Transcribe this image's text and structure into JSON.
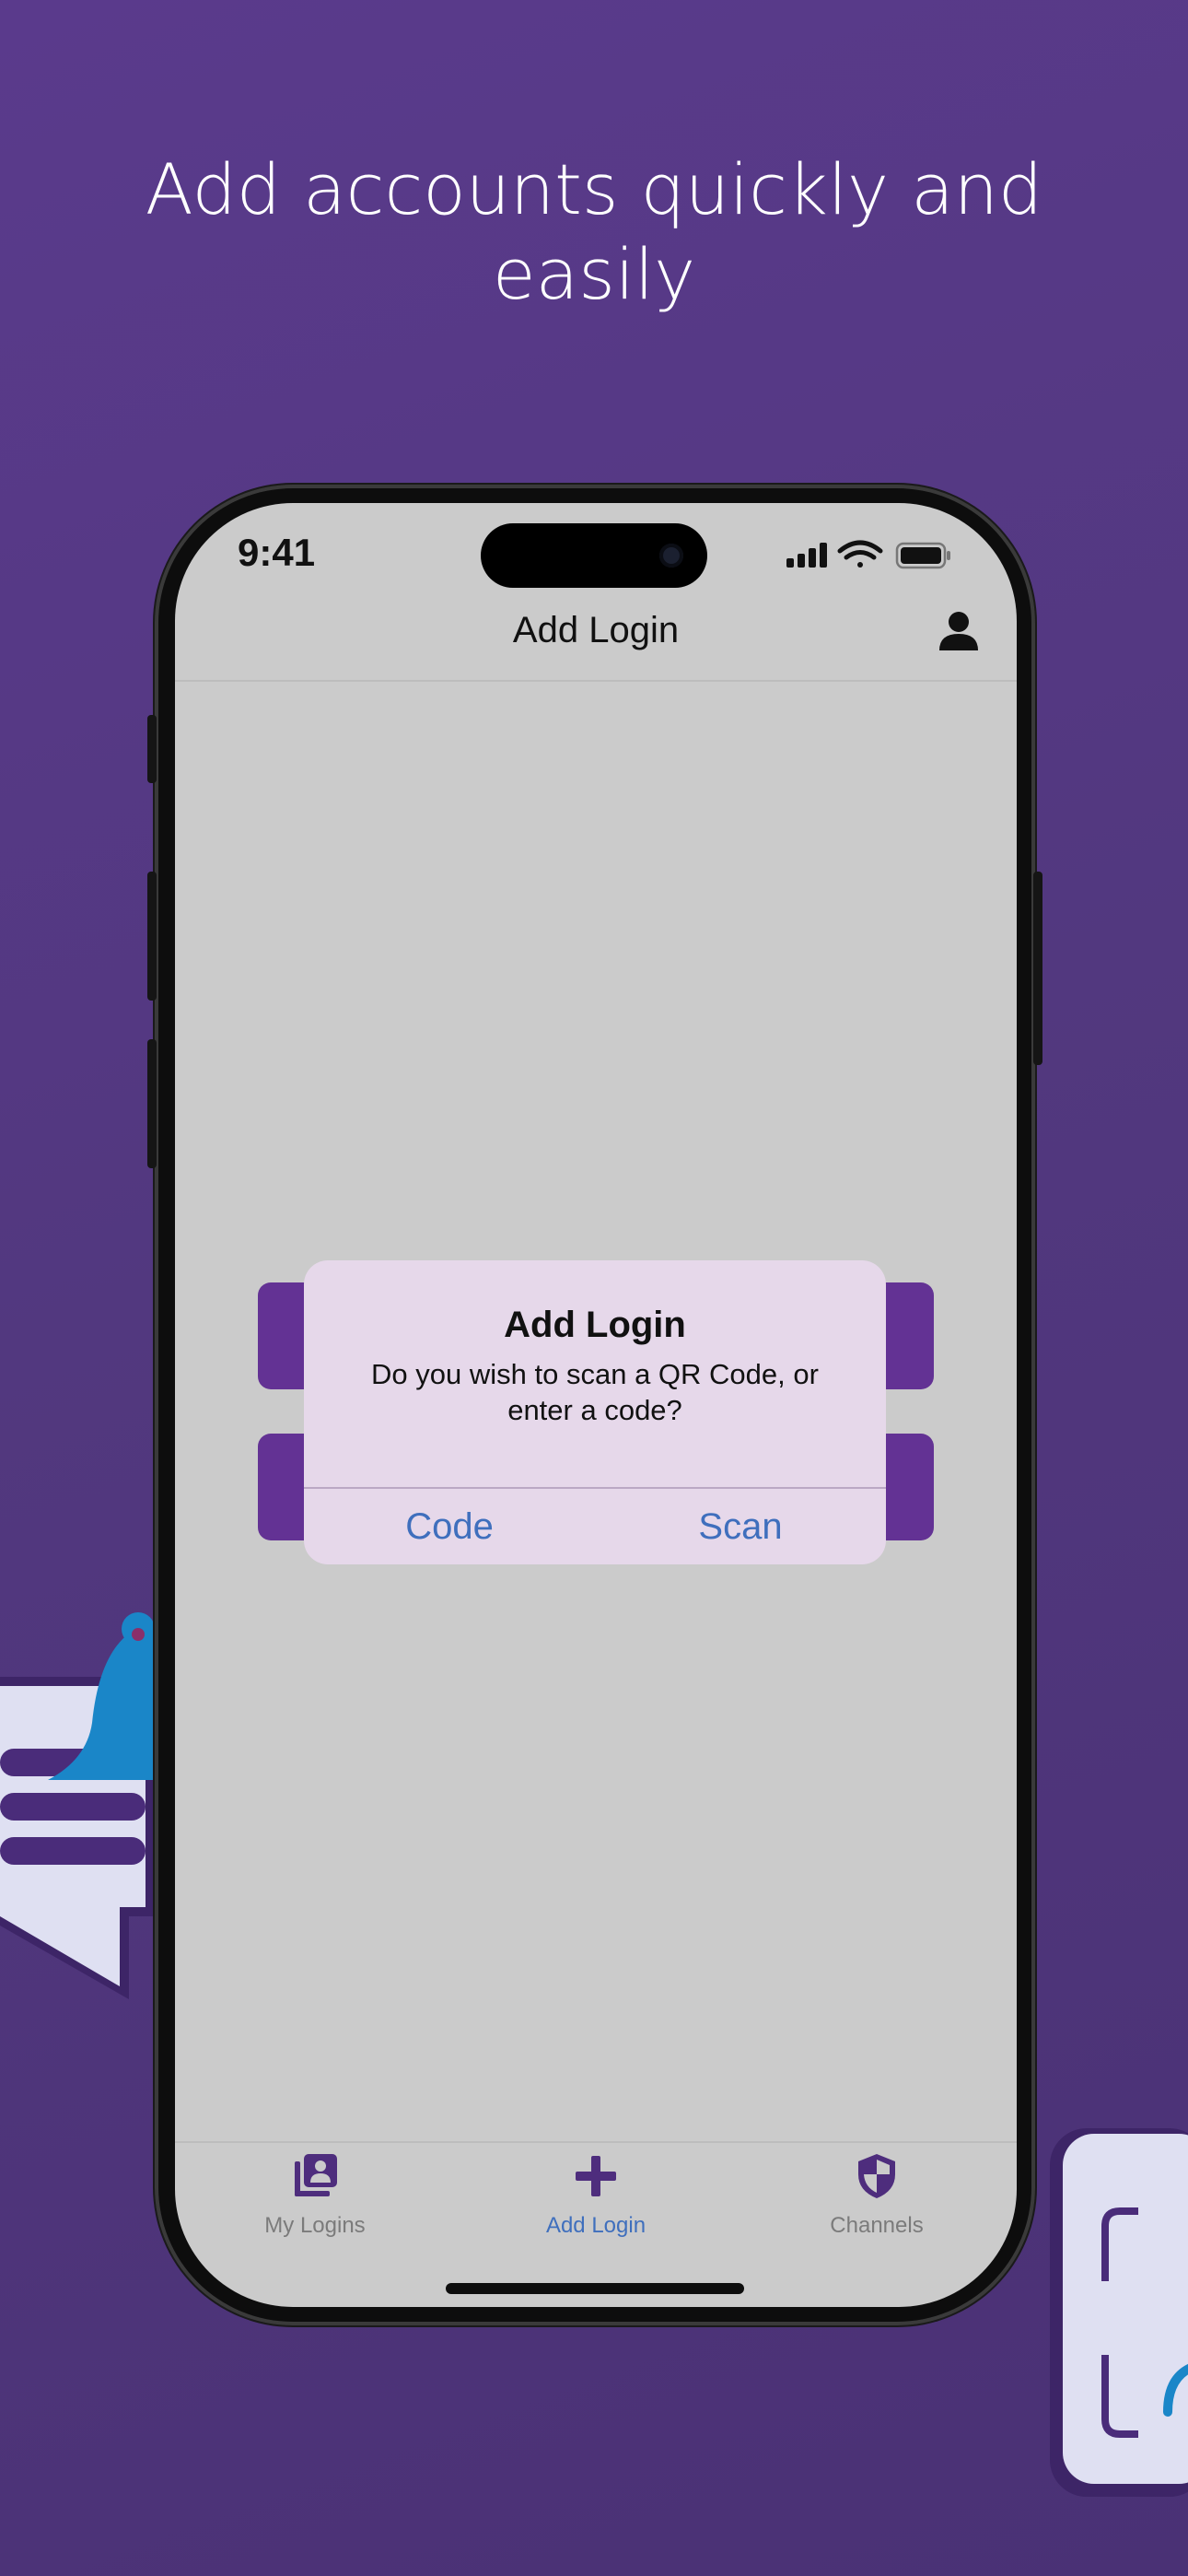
{
  "headline": {
    "line1": "Add accounts quickly and",
    "line2": "easily"
  },
  "status_bar": {
    "time": "9:41",
    "icons": [
      "cellular-signal-icon",
      "wifi-icon",
      "battery-icon"
    ]
  },
  "navbar": {
    "title": "Add Login",
    "right_icon": "profile-icon"
  },
  "alert": {
    "title": "Add Login",
    "message": "Do you wish to scan a QR Code, or enter a code?",
    "buttons": [
      {
        "label": "Code"
      },
      {
        "label": "Scan"
      }
    ]
  },
  "tabbar": {
    "items": [
      {
        "label": "My Logins",
        "icon": "contacts-book-icon",
        "active": false
      },
      {
        "label": "Add Login",
        "icon": "plus-icon",
        "active": true
      },
      {
        "label": "Channels",
        "icon": "shield-icon",
        "active": false
      }
    ]
  },
  "colors": {
    "background": "#52387f",
    "accent_purple": "#633294",
    "link_blue": "#3f6fbd",
    "alert_background": "#e6d8ea",
    "screen_background": "#cbcbcb"
  }
}
